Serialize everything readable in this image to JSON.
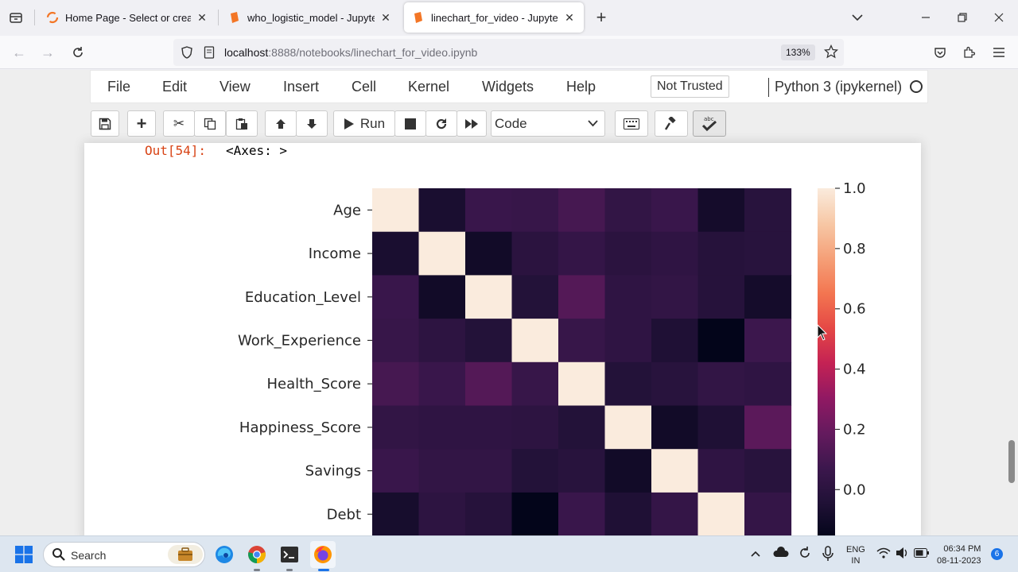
{
  "browser": {
    "tabs": [
      {
        "title": "Home Page - Select or create a",
        "active": false
      },
      {
        "title": "who_logistic_model - Jupyter No",
        "active": false
      },
      {
        "title": "linechart_for_video - Jupyter No",
        "active": true
      }
    ],
    "url_host": "localhost",
    "url_rest": ":8888/notebooks/linechart_for_video.ipynb",
    "zoom": "133%"
  },
  "jupyter": {
    "menu": [
      "File",
      "Edit",
      "View",
      "Insert",
      "Cell",
      "Kernel",
      "Widgets",
      "Help"
    ],
    "trust_status": "Not Trusted",
    "kernel": "Python 3 (ipykernel)",
    "toolbar": {
      "run_label": "Run",
      "cell_type": "Code"
    },
    "output": {
      "prompt": "Out[54]:",
      "text": "<Axes: >"
    }
  },
  "chart_data": {
    "type": "heatmap",
    "rows": [
      "Age",
      "Income",
      "Education_Level",
      "Work_Experience",
      "Health_Score",
      "Happiness_Score",
      "Savings",
      "Debt"
    ],
    "values": [
      [
        1.0,
        -0.07,
        0.06,
        0.05,
        0.1,
        0.03,
        0.06,
        -0.09,
        -0.01
      ],
      [
        -0.07,
        1.0,
        -0.1,
        0.0,
        0.04,
        0.0,
        0.02,
        -0.02,
        -0.01
      ],
      [
        0.06,
        -0.1,
        1.0,
        -0.03,
        0.14,
        0.02,
        0.03,
        -0.02,
        -0.09
      ],
      [
        0.05,
        0.01,
        -0.03,
        1.0,
        0.05,
        0.02,
        -0.05,
        -0.16,
        0.07
      ],
      [
        0.1,
        0.06,
        0.14,
        0.05,
        1.0,
        -0.03,
        -0.01,
        0.03,
        0.02
      ],
      [
        0.03,
        0.02,
        0.02,
        0.01,
        -0.03,
        1.0,
        -0.1,
        -0.05,
        0.16
      ],
      [
        0.06,
        0.03,
        0.03,
        -0.03,
        -0.01,
        -0.1,
        1.0,
        0.02,
        -0.01
      ],
      [
        -0.08,
        0.01,
        -0.02,
        -0.16,
        0.06,
        -0.05,
        0.04,
        1.0,
        0.04
      ]
    ],
    "colorbar_ticks": [
      "1.0",
      "0.8",
      "0.6",
      "0.4",
      "0.2",
      "0.0"
    ]
  },
  "taskbar": {
    "search_label": "Search",
    "lang_line1": "ENG",
    "lang_line2": "IN",
    "time": "06:34 PM",
    "date": "08-11-2023",
    "notifications": "6"
  }
}
